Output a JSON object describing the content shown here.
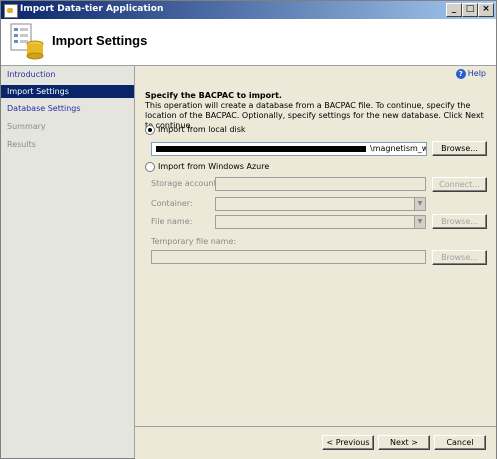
{
  "window": {
    "title": "Import Data-tier Application"
  },
  "header": {
    "title": "Import Settings"
  },
  "sidebar": {
    "items": [
      {
        "label": "Introduction",
        "state": "link"
      },
      {
        "label": "Import Settings",
        "state": "selected"
      },
      {
        "label": "Database Settings",
        "state": "link"
      },
      {
        "label": "Summary",
        "state": "disabled"
      },
      {
        "label": "Results",
        "state": "disabled"
      }
    ]
  },
  "main": {
    "help_label": "Help",
    "heading": "Specify the BACPAC to import.",
    "description": "This operation will create a database from a BACPAC file. To continue, specify the location of the BACPAC.  Optionally, specify settings for the new database. Click Next to continue.",
    "local_disk": {
      "label": "Import from local disk",
      "path_value": "\\magnetism_webs",
      "browse": "Browse..."
    },
    "azure": {
      "label": "Import from Windows Azure",
      "storage_account_label": "Storage account:",
      "connect": "Connect...",
      "container_label": "Container:",
      "file_name_label": "File name:",
      "browse": "Browse...",
      "temp_file_label": "Temporary file name:",
      "temp_browse": "Browse..."
    }
  },
  "footer": {
    "previous": "< Previous",
    "next": "Next >",
    "cancel": "Cancel"
  }
}
